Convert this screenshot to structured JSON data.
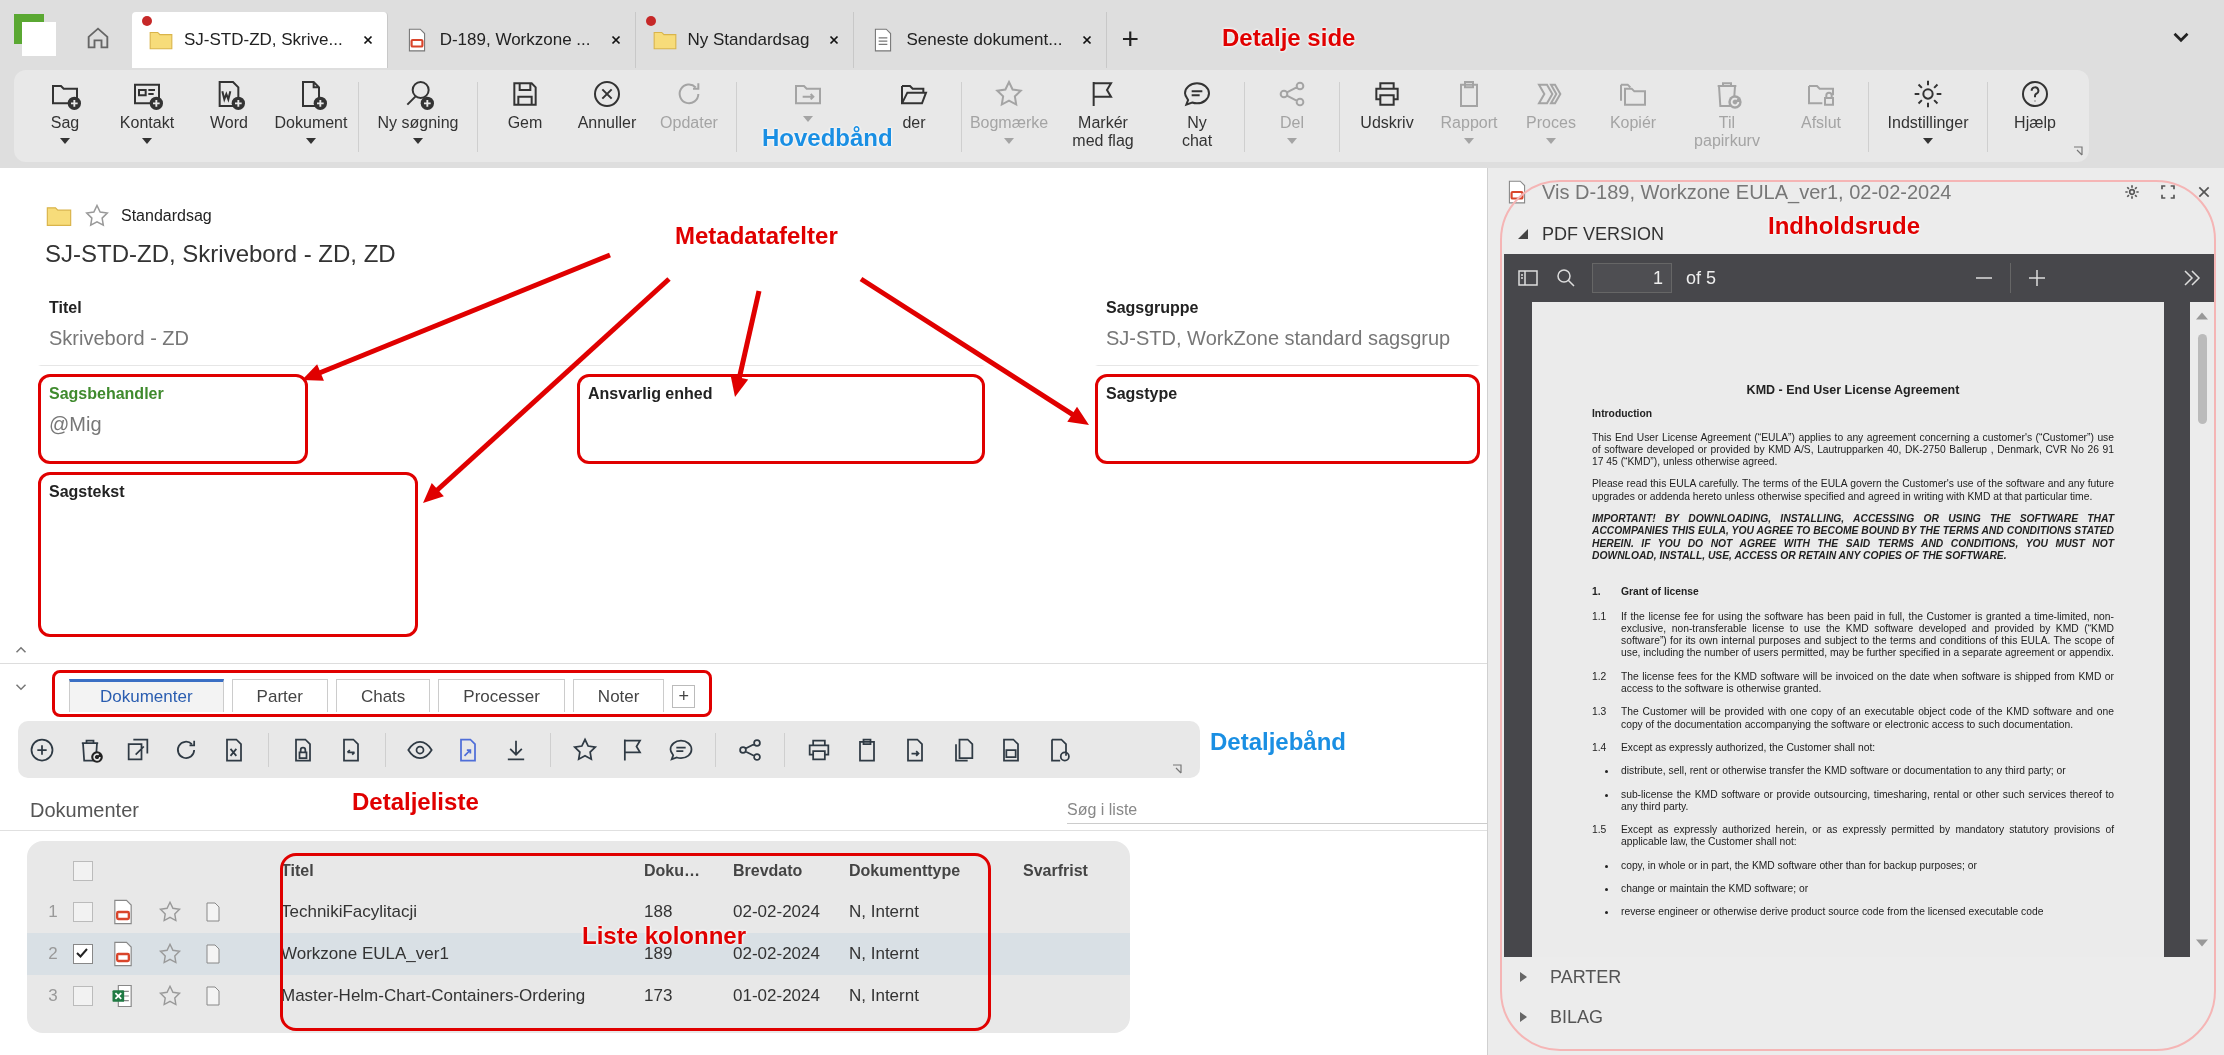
{
  "tabs": [
    {
      "label": "SJ-STD-ZD, Skrive...",
      "kind": "folder",
      "selected": true,
      "unsaved": true
    },
    {
      "label": "D-189, Workzone ...",
      "kind": "pdf",
      "selected": false,
      "unsaved": false
    },
    {
      "label": "Ny Standardsag",
      "kind": "folder",
      "selected": false,
      "unsaved": true
    },
    {
      "label": "Seneste dokument...",
      "kind": "document",
      "selected": false,
      "unsaved": false
    }
  ],
  "new_tab": "+",
  "ribbon": {
    "groups": [
      {
        "buttons": [
          {
            "label": "Sag",
            "disabled": false,
            "dropdown": true
          },
          {
            "label": "Kontakt",
            "disabled": false,
            "dropdown": true
          },
          {
            "label": "Word",
            "disabled": false,
            "dropdown": false
          },
          {
            "label": "Dokument",
            "disabled": false,
            "dropdown": true
          }
        ]
      },
      {
        "buttons": [
          {
            "label": "Ny søgning",
            "disabled": false,
            "dropdown": true
          }
        ]
      },
      {
        "buttons": [
          {
            "label": "Gem",
            "disabled": false,
            "dropdown": false
          },
          {
            "label": "Annuller",
            "disabled": false,
            "dropdown": false
          },
          {
            "label": "Opdater",
            "disabled": true,
            "dropdown": false
          }
        ]
      },
      {
        "buttons": [
          {
            "disabled": true,
            "dropdown": true
          },
          {
            "label": "der",
            "disabled": false,
            "dropdown": false
          }
        ]
      },
      {
        "buttons": [
          {
            "label": "Bogmærke",
            "disabled": true,
            "dropdown": true
          },
          {
            "label": "Markér\nmed flag",
            "disabled": false,
            "dropdown": false
          },
          {
            "label": "Ny\nchat",
            "disabled": false,
            "dropdown": false
          }
        ]
      },
      {
        "buttons": [
          {
            "label": "Del",
            "disabled": true,
            "dropdown": true
          }
        ]
      },
      {
        "buttons": [
          {
            "label": "Udskriv",
            "disabled": false,
            "dropdown": false
          },
          {
            "label": "Rapport",
            "disabled": true,
            "dropdown": true
          },
          {
            "label": "Proces",
            "disabled": true,
            "dropdown": true
          },
          {
            "label": "Kopiér",
            "disabled": true,
            "dropdown": false
          },
          {
            "label": "Til\npapirkurv",
            "disabled": true,
            "dropdown": false
          },
          {
            "label": "Afslut",
            "disabled": true,
            "dropdown": false
          }
        ]
      },
      {
        "buttons": [
          {
            "label": "Indstillinger",
            "disabled": false,
            "dropdown": true
          }
        ]
      },
      {
        "buttons": [
          {
            "label": "Hjælp",
            "disabled": false,
            "dropdown": false
          }
        ]
      }
    ]
  },
  "annotations": [
    {
      "text": "Detalje side",
      "color": "#e00000"
    },
    {
      "text": "Hovedbånd",
      "color": "#1a8fe3"
    },
    {
      "text": "Metadatafelter",
      "color": "#e00000"
    },
    {
      "text": "Indholdsrude",
      "color": "#e00000"
    },
    {
      "text": "Detaljebånd",
      "color": "#1a8fe3"
    },
    {
      "text": "Detaljeliste",
      "color": "#e00000"
    },
    {
      "text": "Liste kolonner",
      "color": "#e00000"
    }
  ],
  "case": {
    "type": "Standardsag",
    "title": "SJ-STD-ZD, Skrivebord - ZD, ZD"
  },
  "fields": [
    {
      "label": "Titel",
      "value": "Skrivebord - ZD",
      "required": false,
      "highlighted": false
    },
    {
      "label": "Sagsgruppe",
      "value": "SJ-STD, WorkZone standard sagsgrup",
      "required": false,
      "highlighted": false
    },
    {
      "label": "Sagsbehandler",
      "value": "@Mig",
      "required": true,
      "highlighted": true
    },
    {
      "label": "Ansvarlig enhed",
      "required": false,
      "highlighted": true
    },
    {
      "label": "Sagstype",
      "required": false,
      "highlighted": true
    },
    {
      "label": "Sagstekst",
      "required": false,
      "highlighted": true
    }
  ],
  "detail_tabs": {
    "highlighted": true,
    "add": "+",
    "items": [
      {
        "label": "Dokumenter",
        "selected": true
      },
      {
        "label": "Parter",
        "selected": false
      },
      {
        "label": "Chats",
        "selected": false
      },
      {
        "label": "Processer",
        "selected": false
      },
      {
        "label": "Noter",
        "selected": false
      }
    ]
  },
  "list": {
    "title": "Dokumenter",
    "search_placeholder": "Søg i liste",
    "highlighted": true,
    "all_selected": false,
    "columns": [
      "Titel",
      "Doku…",
      "Brevdato",
      "Dokumenttype",
      "Svarfrist"
    ],
    "rows": [
      {
        "number": "1",
        "selected": false,
        "kind": "pdf",
        "title": "TechnikiFacylitacji",
        "doc_no": "188",
        "date": "02-02-2024",
        "doc_type": "N, Internt"
      },
      {
        "number": "2",
        "selected": true,
        "kind": "pdf",
        "title": "Workzone EULA_ver1",
        "doc_no": "189",
        "date": "02-02-2024",
        "doc_type": "N, Internt"
      },
      {
        "number": "3",
        "selected": false,
        "kind": "excel",
        "title": "Master-Helm-Chart-Containers-Ordering",
        "doc_no": "173",
        "date": "01-02-2024",
        "doc_type": "N, Internt"
      }
    ]
  },
  "viewer": {
    "title": "Vis D-189, Workzone EULA_ver1, 02-02-2024",
    "section": "PDF VERSION",
    "expanded": true,
    "page": "1",
    "page_count": "of 5",
    "document": [
      {
        "kind": "title",
        "text": "KMD - End User License Agreement"
      },
      {
        "kind": "heading",
        "text": "Introduction"
      },
      {
        "kind": "para",
        "text": "This End User License Agreement (“EULA”) applies to any agreement concerning a customer's (“Customer”) use of software developed or provided by KMD A/S, Lautrupparken 40, DK-2750 Ballerup , Denmark, CVR No 26 91 17 45 (“KMD”), unless otherwise agreed."
      },
      {
        "kind": "para",
        "text": "Please read this EULA carefully. The terms of the EULA govern the Customer's use of the software and any future upgrades or addenda hereto unless otherwise specified and agreed in writing with KMD at that particular time."
      },
      {
        "kind": "important",
        "text": "IMPORTANT! BY DOWNLOADING, INSTALLING, ACCESSING OR USING THE SOFTWARE THAT ACCOMPANIES THIS EULA, YOU AGREE TO BECOME BOUND BY THE TERMS AND CONDITIONS STATED HEREIN. IF YOU DO NOT AGREE WITH THE SAID TERMS AND CONDITIONS, YOU MUST NOT DOWNLOAD, INSTALL, USE, ACCESS OR RETAIN ANY COPIES OF THE SOFTWARE."
      },
      {
        "kind": "section",
        "number": "1.",
        "text": "Grant of license"
      },
      {
        "kind": "clause",
        "number": "1.1",
        "text": "If the license fee for using the software has been paid in full, the Customer is granted a time-limited, non-exclusive, non-transferable license to use the KMD software developed and provided by KMD (“KMD software”) for its own internal purposes and subject to the terms and conditions of this EULA. The scope of use, including the number of users permitted, may be further specified in a separate agreement or appendix."
      },
      {
        "kind": "clause",
        "number": "1.2",
        "text": "The license fees for the KMD software will be invoiced on the date when software is shipped from KMD or access to the software is otherwise granted."
      },
      {
        "kind": "clause",
        "number": "1.3",
        "text": "The Customer will be provided with one copy of an executable object code of the KMD software and one copy of the documentation accompanying the software or electronic access to such documentation."
      },
      {
        "kind": "clause",
        "number": "1.4",
        "text": "Except as expressly authorized, the Customer shall not:"
      },
      {
        "kind": "bullet",
        "text": "distribute, sell, rent or otherwise transfer the KMD software or documentation to any third party; or"
      },
      {
        "kind": "bullet",
        "text": "sub-license the KMD software or provide outsourcing, timesharing, rental or other such services thereof to any third party."
      },
      {
        "kind": "clause",
        "number": "1.5",
        "text": "Except as expressly authorized herein, or as expressly permitted by mandatory statutory provisions of applicable law, the Customer shall not:"
      },
      {
        "kind": "bullet",
        "text": "copy, in whole or in part, the KMD software other than for backup purposes; or"
      },
      {
        "kind": "bullet",
        "text": "change or maintain the KMD software; or"
      },
      {
        "kind": "bullet",
        "text": "reverse engineer or otherwise derive product source code from the licensed executable code"
      }
    ],
    "sections": [
      {
        "label": "PARTER",
        "expanded": false
      },
      {
        "label": "BILAG",
        "expanded": false
      }
    ]
  }
}
